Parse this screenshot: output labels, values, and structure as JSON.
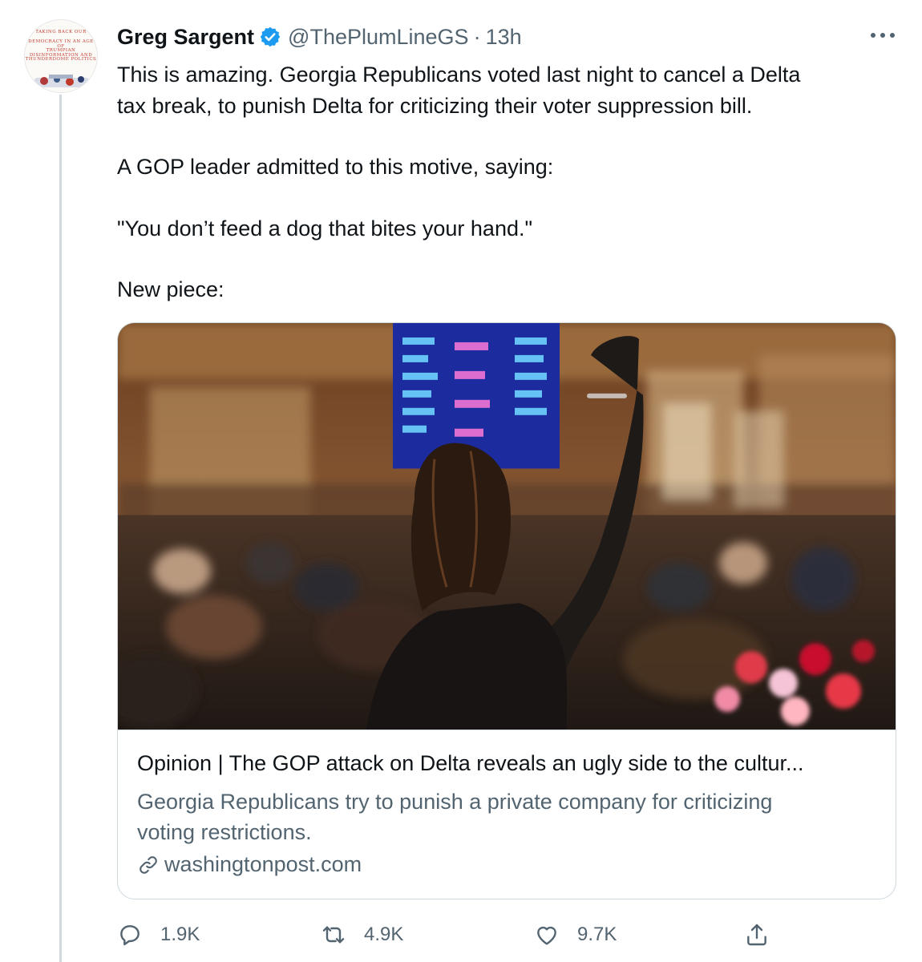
{
  "author": {
    "name": "Greg Sargent",
    "handle": "@ThePlumLineGS",
    "separator": "·",
    "time": "13h",
    "verified": true,
    "avatar_cover_lines": [
      "TAKING BACK OUR",
      "DEMOCRACY IN AN AGE OF",
      "TRUMPIAN DISINFORMATION AND",
      "THUNDERDOME POLITICS"
    ]
  },
  "tweet": {
    "paragraphs": [
      [
        "This is amazing. Georgia Republicans voted last night to cancel a Delta",
        "tax break, to punish Delta for criticizing their voter suppression bill."
      ],
      [
        "A GOP leader admitted to this motive, saying:"
      ],
      [
        "\"You don’t feed a dog that bites your hand.\""
      ],
      [
        "New piece:"
      ]
    ]
  },
  "card": {
    "title": "Opinion | The GOP attack on Delta reveals an ugly side to the cultur...",
    "description_lines": [
      "Georgia Republicans try to punish a private company for criticizing",
      "voting restrictions."
    ],
    "domain": "washingtonpost.com"
  },
  "actions": {
    "reply_count": "1.9K",
    "retweet_count": "4.9K",
    "like_count": "9.7K"
  },
  "colors": {
    "text_primary": "#0f1419",
    "text_secondary": "#536471",
    "verified_blue": "#1d9bf0",
    "border": "#cfd9de"
  },
  "icons": [
    "verified-badge-icon",
    "more-icon",
    "link-icon",
    "reply-icon",
    "retweet-icon",
    "like-icon",
    "share-icon"
  ]
}
